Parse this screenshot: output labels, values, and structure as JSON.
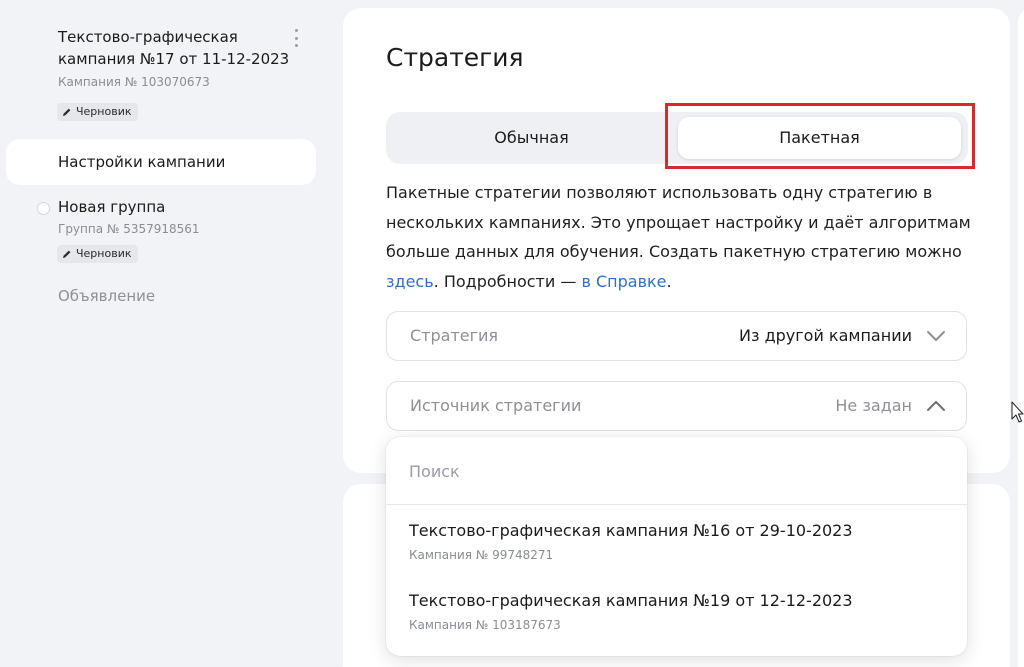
{
  "sidebar": {
    "campaign_title": "Текстово-графическая кампания №17 от 11-12-2023",
    "campaign_number": "Кампания № 103070673",
    "campaign_status": "Черновик",
    "settings_item": "Настройки кампании",
    "group_title": "Новая группа",
    "group_number": "Группа № 5357918561",
    "group_status": "Черновик",
    "ad_item": "Объявление"
  },
  "main": {
    "title": "Стратегия",
    "tabs": [
      {
        "label": "Обычная",
        "selected": false
      },
      {
        "label": "Пакетная",
        "selected": true
      }
    ],
    "description": {
      "text_before_link": "Пакетные стратегии позволяют использовать одну стратегию в нескольких кампаниях. Это упрощает настройку и даёт алгоритмам больше данных для обучения. Создать пакетную стратегию можно ",
      "link_here": "здесь",
      "text_middle": ". Подробности — ",
      "link_help": "в Справке",
      "text_end": "."
    },
    "strategy_field": {
      "label": "Стратегия",
      "value": "Из другой кампании"
    },
    "source_field": {
      "label": "Источник стратегии",
      "value": "Не задан"
    },
    "dropdown": {
      "search_placeholder": "Поиск",
      "options": [
        {
          "title": "Текстово-графическая кампания №16 от 29-10-2023",
          "subtitle": "Кампания № 99748271"
        },
        {
          "title": "Текстово-графическая кампания №19 от 12-12-2023",
          "subtitle": "Кампания № 103187673"
        }
      ]
    }
  },
  "colors": {
    "link": "#2d6fd6",
    "highlight_frame": "#d72a2a",
    "background": "#f2f3f6"
  },
  "icons": [
    "pencil-icon",
    "more-vertical-icon",
    "chevron-down-icon",
    "chevron-up-icon",
    "mouse-cursor-icon"
  ]
}
